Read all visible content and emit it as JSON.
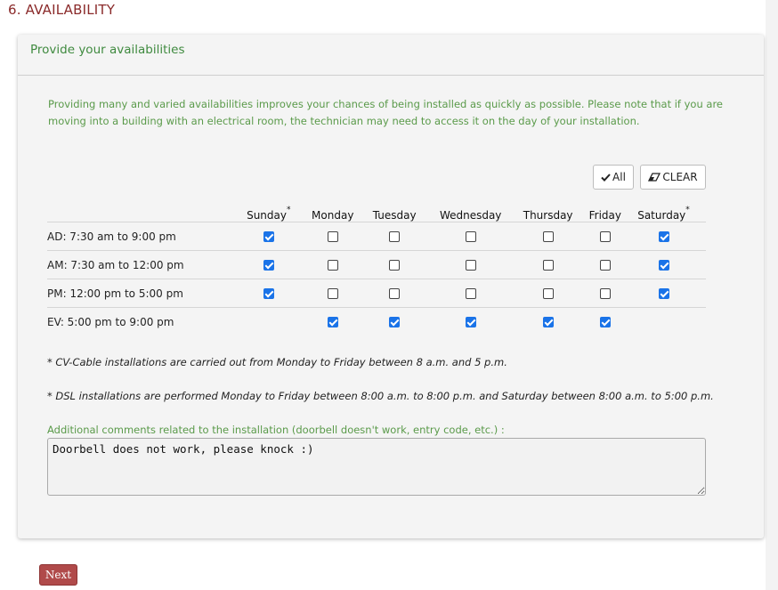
{
  "section": {
    "title": "6. AVAILABILITY"
  },
  "card": {
    "header": "Provide your availabilities",
    "intro": "Providing many and varied availabilities improves your chances of being installed as quickly as possible. Please note that if you are moving into a building with an electrical room, the technician may need to access it on the day of your installation."
  },
  "buttons": {
    "all_label": "All",
    "clear_label": "CLEAR"
  },
  "table": {
    "days": [
      "Sunday",
      "Monday",
      "Tuesday",
      "Wednesday",
      "Thursday",
      "Friday",
      "Saturday"
    ],
    "asterisk": "*",
    "rows": [
      {
        "label": "AD: 7:30 am to 9:00 pm",
        "checks": [
          true,
          false,
          false,
          false,
          false,
          false,
          true
        ]
      },
      {
        "label": "AM: 7:30 am to 12:00 pm",
        "checks": [
          true,
          false,
          false,
          false,
          false,
          false,
          true
        ]
      },
      {
        "label": "PM: 12:00 pm to 5:00 pm",
        "checks": [
          true,
          false,
          false,
          false,
          false,
          false,
          true
        ]
      },
      {
        "label": "EV: 5:00 pm to 9:00 pm",
        "checks": [
          null,
          true,
          true,
          true,
          true,
          true,
          null
        ]
      }
    ]
  },
  "notes": {
    "cable": "* CV-Cable installations are carried out from Monday to Friday between 8 a.m. and 5 p.m.",
    "dsl": "* DSL installations are performed Monday to Friday between 8:00 a.m. to 8:00 p.m. and Saturday between 8:00 a.m. to 5:00 p.m."
  },
  "comments": {
    "label": "Additional comments related to the installation (doorbell doesn't work, entry code, etc.) :",
    "value": "Doorbell does not work, please knock :)"
  },
  "next_label": "Next",
  "colors": {
    "title": "#8a2a2a",
    "green": "#5a9a4a",
    "checkbox": "#1a73e8",
    "next": "#b04a4a"
  }
}
